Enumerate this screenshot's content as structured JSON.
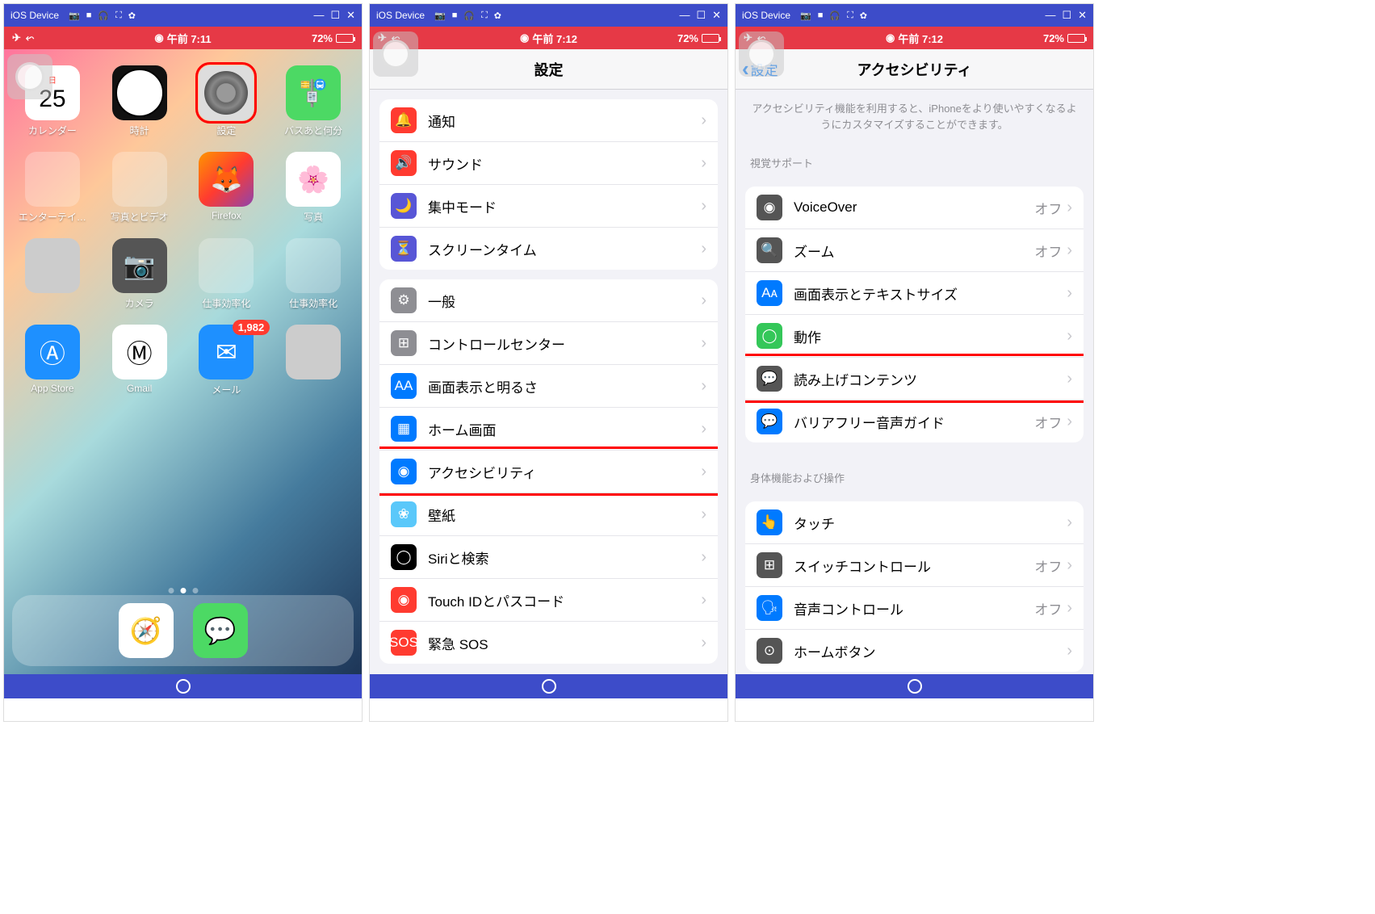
{
  "titlebar": {
    "title": "iOS Device"
  },
  "status": {
    "time1": "午前 7:11",
    "time2": "午前 7:12",
    "battery": "72%"
  },
  "home": {
    "calendar_day": "日",
    "calendar_date": "25",
    "apps": {
      "calendar": "カレンダー",
      "clock": "時計",
      "settings": "設定",
      "bus": "バスあと何分",
      "entertain": "エンターテイ…",
      "photovideo": "写真とビデオ",
      "firefox": "Firefox",
      "photos": "写真",
      "camera": "カメラ",
      "work1": "仕事効率化",
      "work2": "仕事効率化",
      "appstore": "App Store",
      "gmail": "Gmail",
      "mail": "メール"
    },
    "mail_badge": "1,982"
  },
  "settings": {
    "title": "設定",
    "rows": {
      "notifications": "通知",
      "sounds": "サウンド",
      "focus": "集中モード",
      "screentime": "スクリーンタイム",
      "general": "一般",
      "controlcenter": "コントロールセンター",
      "display": "画面表示と明るさ",
      "homescreen": "ホーム画面",
      "accessibility": "アクセシビリティ",
      "wallpaper": "壁紙",
      "siri": "Siriと検索",
      "touchid": "Touch IDとパスコード",
      "sos": "緊急 SOS"
    }
  },
  "accessibility": {
    "title": "アクセシビリティ",
    "back": "設定",
    "intro": "アクセシビリティ機能を利用すると、iPhoneをより使いやすくなるようにカスタマイズすることができます。",
    "group_visual": "視覚サポート",
    "group_body": "身体機能および操作",
    "off": "オフ",
    "rows": {
      "voiceover": "VoiceOver",
      "zoom": "ズーム",
      "textsize": "画面表示とテキストサイズ",
      "motion": "動作",
      "spoken": "読み上げコンテンツ",
      "audiodesc": "バリアフリー音声ガイド",
      "touch": "タッチ",
      "switchcontrol": "スイッチコントロール",
      "voicecontrol": "音声コントロール",
      "homebutton": "ホームボタン"
    }
  }
}
